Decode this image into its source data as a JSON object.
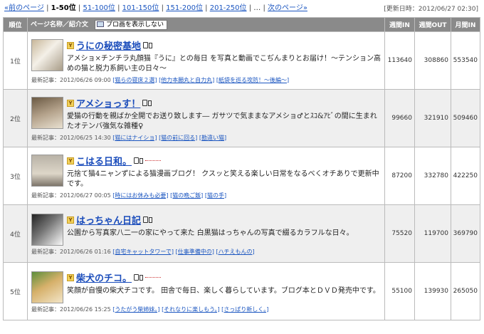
{
  "pager": {
    "prev": "«前のページ",
    "current": "1-50位",
    "links": [
      "51-100位",
      "101-150位",
      "151-200位",
      "201-250位"
    ],
    "ellipsis": "…",
    "next": "次のページ»"
  },
  "updated": "[更新日時：2012/06/27 02:30]",
  "table": {
    "headers": {
      "rank": "順位",
      "name": "ページ名称／紹介文",
      "toggle": "プロ画を表示しない",
      "in_week": "週間IN",
      "out_week": "週間OUT",
      "in_month": "月間IN"
    },
    "rows": [
      {
        "rank": "1位",
        "title": "うにの秘密基地",
        "desc": "アメショ×チンチラ丸顔猫『うに』との毎日 を写真と動画でこぢんまりとお届け！～テンション高めの猫と脱力系飼い主の日々～",
        "latest_label": "最新記事：2012/06/26 09:00",
        "latest_links": [
          "[猫らの寝床２選]",
          "[他力本願丸と自力丸]",
          "[紙袋を巡る攻防！～後編～]"
        ],
        "in_week": "113640",
        "out_week": "308860",
        "in_month": "553540"
      },
      {
        "rank": "2位",
        "title": "アメショっす！",
        "desc": "愛猫の行動を親ばか全開でお送り致します― ガサツで気ままなアメショ♂とｽｺ&ｱﾋﾞの間に生まれたオテンバ強気な雑種♀",
        "latest_label": "最新記事：2012/06/25 14:30",
        "latest_links": [
          "[猫にはナイショ]",
          "[猫の前に回る]",
          "[勘違い猫]"
        ],
        "in_week": "99660",
        "out_week": "321910",
        "in_month": "509460"
      },
      {
        "rank": "3位",
        "title": "こはる日和。",
        "desc": "元捨て猫4ニャンずによる猫漫画ブログ！ クスッと笑える楽しい日常をなるべくオチありで更新中です。",
        "latest_label": "最新記事：2012/06/27 00:05",
        "latest_links": [
          "[時にはお休みも必要]",
          "[猫の晩ご飯]",
          "[猫の手]"
        ],
        "in_week": "87200",
        "out_week": "332780",
        "in_month": "422250"
      },
      {
        "rank": "4位",
        "title": "はっちゃん日記",
        "desc": "公園から写真家八二一の家にやって来た 白黒猫はっちゃんの写真で綴るカラフルな日々。",
        "latest_label": "最新記事：2012/06/26 01:16",
        "latest_links": [
          "[自宅キャットタワーで]",
          "[仕事準備中の]",
          "[ハチえもんの]"
        ],
        "in_week": "75520",
        "out_week": "119700",
        "in_month": "369790"
      },
      {
        "rank": "5位",
        "title": "柴犬のチコ。",
        "desc": "笑顔が自慢の柴犬チコです。 田舎で毎日、楽しく暮らしています。ブログ本とＤＶＤ発売中です。",
        "latest_label": "最新記事：2012/06/26 15:25",
        "latest_links": [
          "[うたがう柴姉妹。]",
          "[それなりに楽しもう。]",
          "[さっぱり新しく。]"
        ],
        "in_week": "55100",
        "out_week": "139930",
        "in_month": "265050"
      }
    ]
  }
}
